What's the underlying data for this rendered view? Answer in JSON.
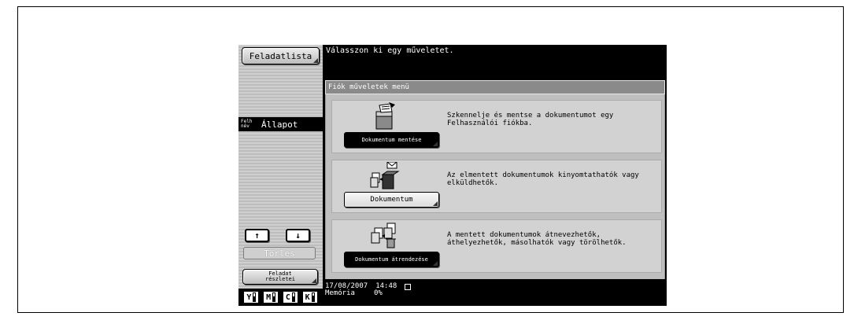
{
  "left_panel": {
    "job_list_button": "Feladatlista",
    "status_header": {
      "user_name_label": "Felh név",
      "status_label": "Állapot"
    },
    "up_arrow": "↑",
    "down_arrow": "↓",
    "delete_button": "Törlés",
    "job_details_button": "Feladat részletei",
    "toner": [
      {
        "name": "Y",
        "level": 0.6
      },
      {
        "name": "M",
        "level": 0.6
      },
      {
        "name": "C",
        "level": 0.6
      },
      {
        "name": "K",
        "level": 0.7
      }
    ]
  },
  "message": "Válasszon ki egy műveletet.",
  "menu": {
    "title": "Fiók műveletek menü",
    "items": [
      {
        "button": "Dokumentum mentése",
        "description": "Szkennelje és mentse a dokumentumot egy Felhasználói fiókba.",
        "icon": "save-document-icon"
      },
      {
        "button": "Dokumentum",
        "description": "Az elmentett dokumentumok kinyomtathatók vagy elküldhetők.",
        "icon": "use-document-icon"
      },
      {
        "button": "Dokumentum átrendezése",
        "description": "A mentett dokumentumok átnevezhetők, áthelyezhetők, másolhatók vagy törölhetők.",
        "icon": "organize-document-icon"
      }
    ]
  },
  "footer": {
    "date": "17/08/2007",
    "time": "14:48",
    "memory_label": "Memória",
    "memory_value": "0%"
  }
}
